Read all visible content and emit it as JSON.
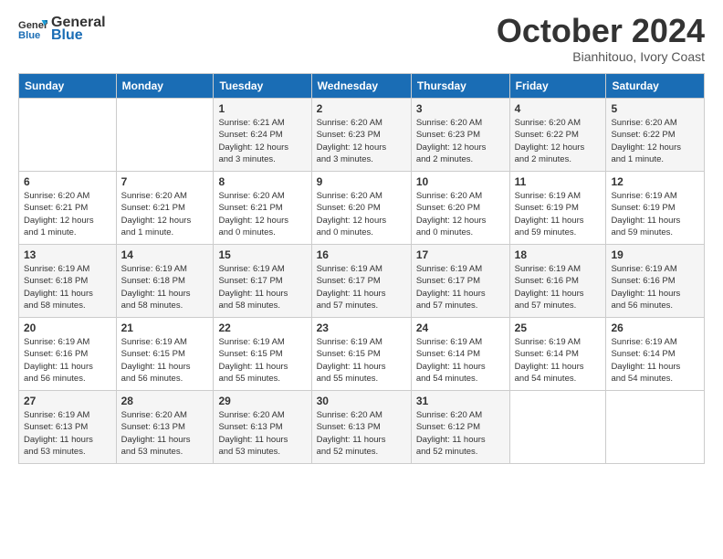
{
  "logo": {
    "line1": "General",
    "line2": "Blue"
  },
  "title": "October 2024",
  "subtitle": "Bianhitouo, Ivory Coast",
  "days_header": [
    "Sunday",
    "Monday",
    "Tuesday",
    "Wednesday",
    "Thursday",
    "Friday",
    "Saturday"
  ],
  "weeks": [
    [
      {
        "day": "",
        "info": ""
      },
      {
        "day": "",
        "info": ""
      },
      {
        "day": "1",
        "info": "Sunrise: 6:21 AM\nSunset: 6:24 PM\nDaylight: 12 hours\nand 3 minutes."
      },
      {
        "day": "2",
        "info": "Sunrise: 6:20 AM\nSunset: 6:23 PM\nDaylight: 12 hours\nand 3 minutes."
      },
      {
        "day": "3",
        "info": "Sunrise: 6:20 AM\nSunset: 6:23 PM\nDaylight: 12 hours\nand 2 minutes."
      },
      {
        "day": "4",
        "info": "Sunrise: 6:20 AM\nSunset: 6:22 PM\nDaylight: 12 hours\nand 2 minutes."
      },
      {
        "day": "5",
        "info": "Sunrise: 6:20 AM\nSunset: 6:22 PM\nDaylight: 12 hours\nand 1 minute."
      }
    ],
    [
      {
        "day": "6",
        "info": "Sunrise: 6:20 AM\nSunset: 6:21 PM\nDaylight: 12 hours\nand 1 minute."
      },
      {
        "day": "7",
        "info": "Sunrise: 6:20 AM\nSunset: 6:21 PM\nDaylight: 12 hours\nand 1 minute."
      },
      {
        "day": "8",
        "info": "Sunrise: 6:20 AM\nSunset: 6:21 PM\nDaylight: 12 hours\nand 0 minutes."
      },
      {
        "day": "9",
        "info": "Sunrise: 6:20 AM\nSunset: 6:20 PM\nDaylight: 12 hours\nand 0 minutes."
      },
      {
        "day": "10",
        "info": "Sunrise: 6:20 AM\nSunset: 6:20 PM\nDaylight: 12 hours\nand 0 minutes."
      },
      {
        "day": "11",
        "info": "Sunrise: 6:19 AM\nSunset: 6:19 PM\nDaylight: 11 hours\nand 59 minutes."
      },
      {
        "day": "12",
        "info": "Sunrise: 6:19 AM\nSunset: 6:19 PM\nDaylight: 11 hours\nand 59 minutes."
      }
    ],
    [
      {
        "day": "13",
        "info": "Sunrise: 6:19 AM\nSunset: 6:18 PM\nDaylight: 11 hours\nand 58 minutes."
      },
      {
        "day": "14",
        "info": "Sunrise: 6:19 AM\nSunset: 6:18 PM\nDaylight: 11 hours\nand 58 minutes."
      },
      {
        "day": "15",
        "info": "Sunrise: 6:19 AM\nSunset: 6:17 PM\nDaylight: 11 hours\nand 58 minutes."
      },
      {
        "day": "16",
        "info": "Sunrise: 6:19 AM\nSunset: 6:17 PM\nDaylight: 11 hours\nand 57 minutes."
      },
      {
        "day": "17",
        "info": "Sunrise: 6:19 AM\nSunset: 6:17 PM\nDaylight: 11 hours\nand 57 minutes."
      },
      {
        "day": "18",
        "info": "Sunrise: 6:19 AM\nSunset: 6:16 PM\nDaylight: 11 hours\nand 57 minutes."
      },
      {
        "day": "19",
        "info": "Sunrise: 6:19 AM\nSunset: 6:16 PM\nDaylight: 11 hours\nand 56 minutes."
      }
    ],
    [
      {
        "day": "20",
        "info": "Sunrise: 6:19 AM\nSunset: 6:16 PM\nDaylight: 11 hours\nand 56 minutes."
      },
      {
        "day": "21",
        "info": "Sunrise: 6:19 AM\nSunset: 6:15 PM\nDaylight: 11 hours\nand 56 minutes."
      },
      {
        "day": "22",
        "info": "Sunrise: 6:19 AM\nSunset: 6:15 PM\nDaylight: 11 hours\nand 55 minutes."
      },
      {
        "day": "23",
        "info": "Sunrise: 6:19 AM\nSunset: 6:15 PM\nDaylight: 11 hours\nand 55 minutes."
      },
      {
        "day": "24",
        "info": "Sunrise: 6:19 AM\nSunset: 6:14 PM\nDaylight: 11 hours\nand 54 minutes."
      },
      {
        "day": "25",
        "info": "Sunrise: 6:19 AM\nSunset: 6:14 PM\nDaylight: 11 hours\nand 54 minutes."
      },
      {
        "day": "26",
        "info": "Sunrise: 6:19 AM\nSunset: 6:14 PM\nDaylight: 11 hours\nand 54 minutes."
      }
    ],
    [
      {
        "day": "27",
        "info": "Sunrise: 6:19 AM\nSunset: 6:13 PM\nDaylight: 11 hours\nand 53 minutes."
      },
      {
        "day": "28",
        "info": "Sunrise: 6:20 AM\nSunset: 6:13 PM\nDaylight: 11 hours\nand 53 minutes."
      },
      {
        "day": "29",
        "info": "Sunrise: 6:20 AM\nSunset: 6:13 PM\nDaylight: 11 hours\nand 53 minutes."
      },
      {
        "day": "30",
        "info": "Sunrise: 6:20 AM\nSunset: 6:13 PM\nDaylight: 11 hours\nand 52 minutes."
      },
      {
        "day": "31",
        "info": "Sunrise: 6:20 AM\nSunset: 6:12 PM\nDaylight: 11 hours\nand 52 minutes."
      },
      {
        "day": "",
        "info": ""
      },
      {
        "day": "",
        "info": ""
      }
    ]
  ]
}
